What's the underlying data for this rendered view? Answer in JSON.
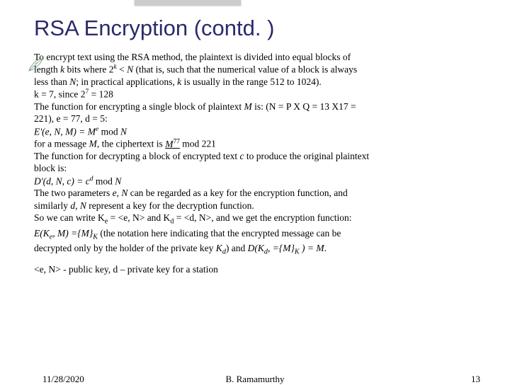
{
  "title": "RSA Encryption (contd. )",
  "body": {
    "p1a": "To encrypt text using the RSA method, the plaintext is divided into equal blocks of",
    "p1b_pre": "length ",
    "p1b_k": "k",
    "p1b_mid": " bits where 2",
    "p1b_sup": "k",
    "p1b_lt": " < ",
    "p1b_N": "N",
    "p1b_post": " (that is, such that the numerical value of a block is always",
    "p1c_pre": "less than ",
    "p1c_N": "N",
    "p1c_mid": "; in practical applications, ",
    "p1c_k": "k",
    "p1c_post": " is usually in the range 512 to 1024).",
    "p2_pre": "k = 7, since 2",
    "p2_sup": "7",
    "p2_post": " = 128",
    "p3_pre": "The function for encrypting a single block of plaintext ",
    "p3_M": "M",
    "p3_post": " is: (N = P X Q = 13 X17 =",
    "p3b": "221), e = 77, d = 5:",
    "p4_pre": "E'(e, N, M) = ",
    "p4_M": "M",
    "p4_sup": "e",
    "p4_mod": " mod ",
    "p4_N": "N",
    "p5_pre": "for a message ",
    "p5_M": "M",
    "p5_mid": ", the ciphertext is ",
    "p5_M2": "M",
    "p5_sup": "77",
    "p5_post": " mod 221",
    "p6_pre": "The function for decrypting a block of encrypted text ",
    "p6_c": "c",
    "p6_post": " to produce the original plaintext",
    "p6b": "block is:",
    "p7_pre": "D'(d, N, c) = ",
    "p7_c": "c",
    "p7_sup": "d",
    "p7_mod": " mod ",
    "p7_N": "N",
    "p8_pre": "The two parameters ",
    "p8_eN": "e, N",
    "p8_mid": " can be regarded as a key for the encryption function, and",
    "p8b_pre": "similarly ",
    "p8b_dN": "d, N",
    "p8b_post": " represent a key for the decryption function.",
    "p9_pre": "So we can write K",
    "p9_sub_e": "e",
    "p9_mid1": " = <e, N> and K",
    "p9_sub_d": "d",
    "p9_post": " = <d, N>, and we get the encryption function:",
    "p10_pre": "E(K",
    "p10_sub_e": "e",
    "p10_mid": ", M) ={",
    "p10_M": "M",
    "p10_brace": "}",
    "p10_sub_K": "K",
    "p10_post": " (the notation here indicating that the encrypted message can be",
    "p10b_pre": "decrypted only by the holder of the private key ",
    "p10b_K": "K",
    "p10b_sub_d": "d",
    "p10b_mid": ") and ",
    "p10b_D": "D(K",
    "p10b_sub_d2": "d",
    "p10b_mid2": ", ={",
    "p10b_M": "M",
    "p10b_brace": "}",
    "p10b_sub_K": "K",
    "p10b_post": " ) = ",
    "p10b_M2": "M",
    "p10b_dot": ".",
    "p11": "<e, N> - public key, d – private key for a station"
  },
  "footer": {
    "date": "11/28/2020",
    "author": "B. Ramamurthy",
    "page": "13"
  }
}
